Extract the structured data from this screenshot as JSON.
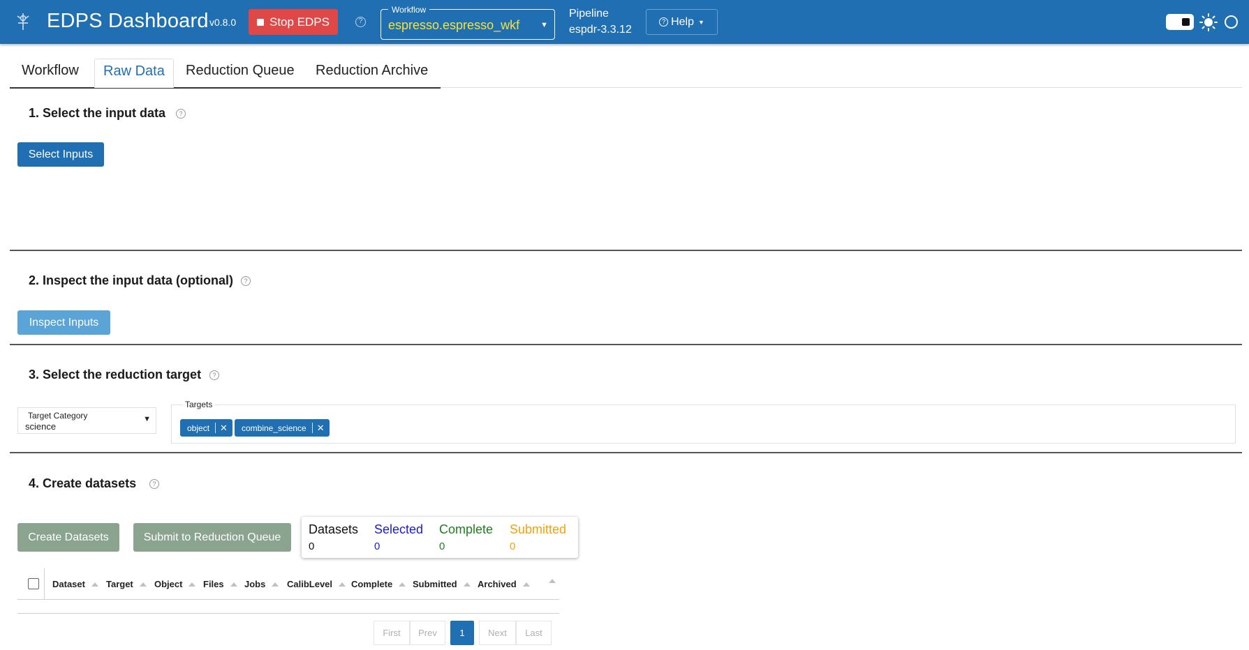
{
  "header": {
    "title": "EDPS Dashboard",
    "version": "v0.8.0",
    "stop_button": "Stop EDPS",
    "workflow_label": "Workflow",
    "workflow_value": "espresso.espresso_wkf",
    "pipeline_label": "Pipeline",
    "pipeline_value": "espdr-3.3.12",
    "help_button": "Help",
    "icons": [
      "edps-logo-icon",
      "stop-icon",
      "help-circle-icon",
      "caret-down-icon",
      "theme-toggle-icon",
      "sun-icon",
      "status-circle-icon"
    ]
  },
  "tabs": [
    {
      "label": "Workflow",
      "active": false
    },
    {
      "label": "Raw Data",
      "active": true
    },
    {
      "label": "Reduction Queue",
      "active": false
    },
    {
      "label": "Reduction Archive",
      "active": false
    }
  ],
  "sections": {
    "select_input": {
      "title": "1. Select the input data",
      "button": "Select Inputs"
    },
    "inspect_input": {
      "title": "2. Inspect the input data (optional)",
      "button": "Inspect Inputs"
    },
    "reduction_target": {
      "title": "3. Select the reduction target",
      "category_label": "Target Category",
      "category_value": "science",
      "targets_label": "Targets",
      "targets": [
        "object",
        "combine_science"
      ]
    },
    "create_datasets": {
      "title": "4. Create datasets",
      "create_button": "Create Datasets",
      "submit_button": "Submit to Reduction Queue",
      "stats": [
        {
          "label": "Datasets",
          "value": "0",
          "color": "#111111"
        },
        {
          "label": "Selected",
          "value": "0",
          "color": "#1a1adb"
        },
        {
          "label": "Complete",
          "value": "0",
          "color": "#1e7d1e"
        },
        {
          "label": "Submitted",
          "value": "0",
          "color": "#f0a30a"
        }
      ]
    }
  },
  "table": {
    "columns": [
      "Dataset",
      "Target",
      "Object",
      "Files",
      "Jobs",
      "CalibLevel",
      "Complete",
      "Submitted",
      "Archived"
    ]
  },
  "pagination": {
    "first": "First",
    "prev": "Prev",
    "current": "1",
    "next": "Next",
    "last": "Last"
  },
  "colors": {
    "brand": "#1f6fb2",
    "stop": "#e04848",
    "workflow_value": "#f6e23a"
  }
}
